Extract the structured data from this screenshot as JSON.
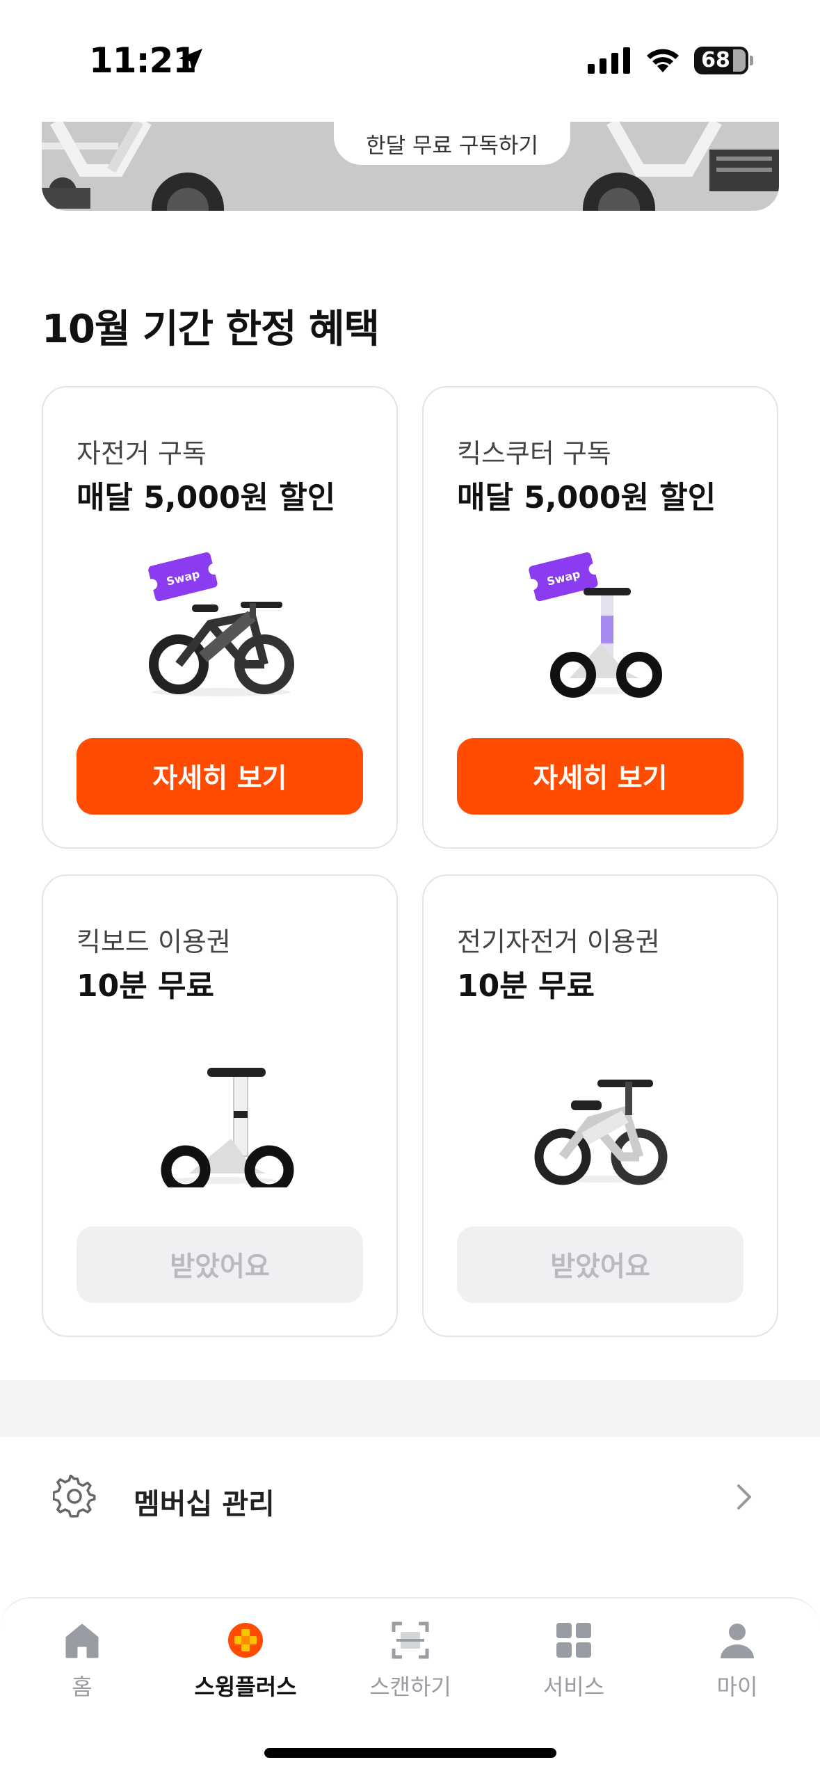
{
  "status_bar": {
    "time": "11:21",
    "battery": "68"
  },
  "banner": {
    "cta_label": "한달 무료 구독하기"
  },
  "section": {
    "title": "10월 기간 한정 혜택"
  },
  "cards": [
    {
      "subtitle": "자전거 구독",
      "title": "매달 5,000원 할인",
      "button": "자세히 보기",
      "ticket": "Swap",
      "state": "active"
    },
    {
      "subtitle": "킥스쿠터 구독",
      "title": "매달 5,000원 할인",
      "button": "자세히 보기",
      "ticket": "Swap",
      "state": "active"
    },
    {
      "subtitle": "킥보드 이용권",
      "title": "10분 무료",
      "button": "받았어요",
      "state": "received"
    },
    {
      "subtitle": "전기자전거 이용권",
      "title": "10분 무료",
      "button": "받았어요",
      "state": "received"
    }
  ],
  "membership": {
    "label": "멤버십 관리"
  },
  "tabs": [
    {
      "label": "홈",
      "icon": "home-icon",
      "active": false
    },
    {
      "label": "스윙플러스",
      "icon": "swing-plus-icon",
      "active": true
    },
    {
      "label": "스캔하기",
      "icon": "scan-icon",
      "active": false
    },
    {
      "label": "서비스",
      "icon": "services-grid-icon",
      "active": false
    },
    {
      "label": "마이",
      "icon": "profile-icon",
      "active": false
    }
  ],
  "colors": {
    "accent": "#ff4c00",
    "ticket": "#8b3cf0",
    "disabled_bg": "#eff0f2",
    "disabled_text": "#b8bac0"
  }
}
